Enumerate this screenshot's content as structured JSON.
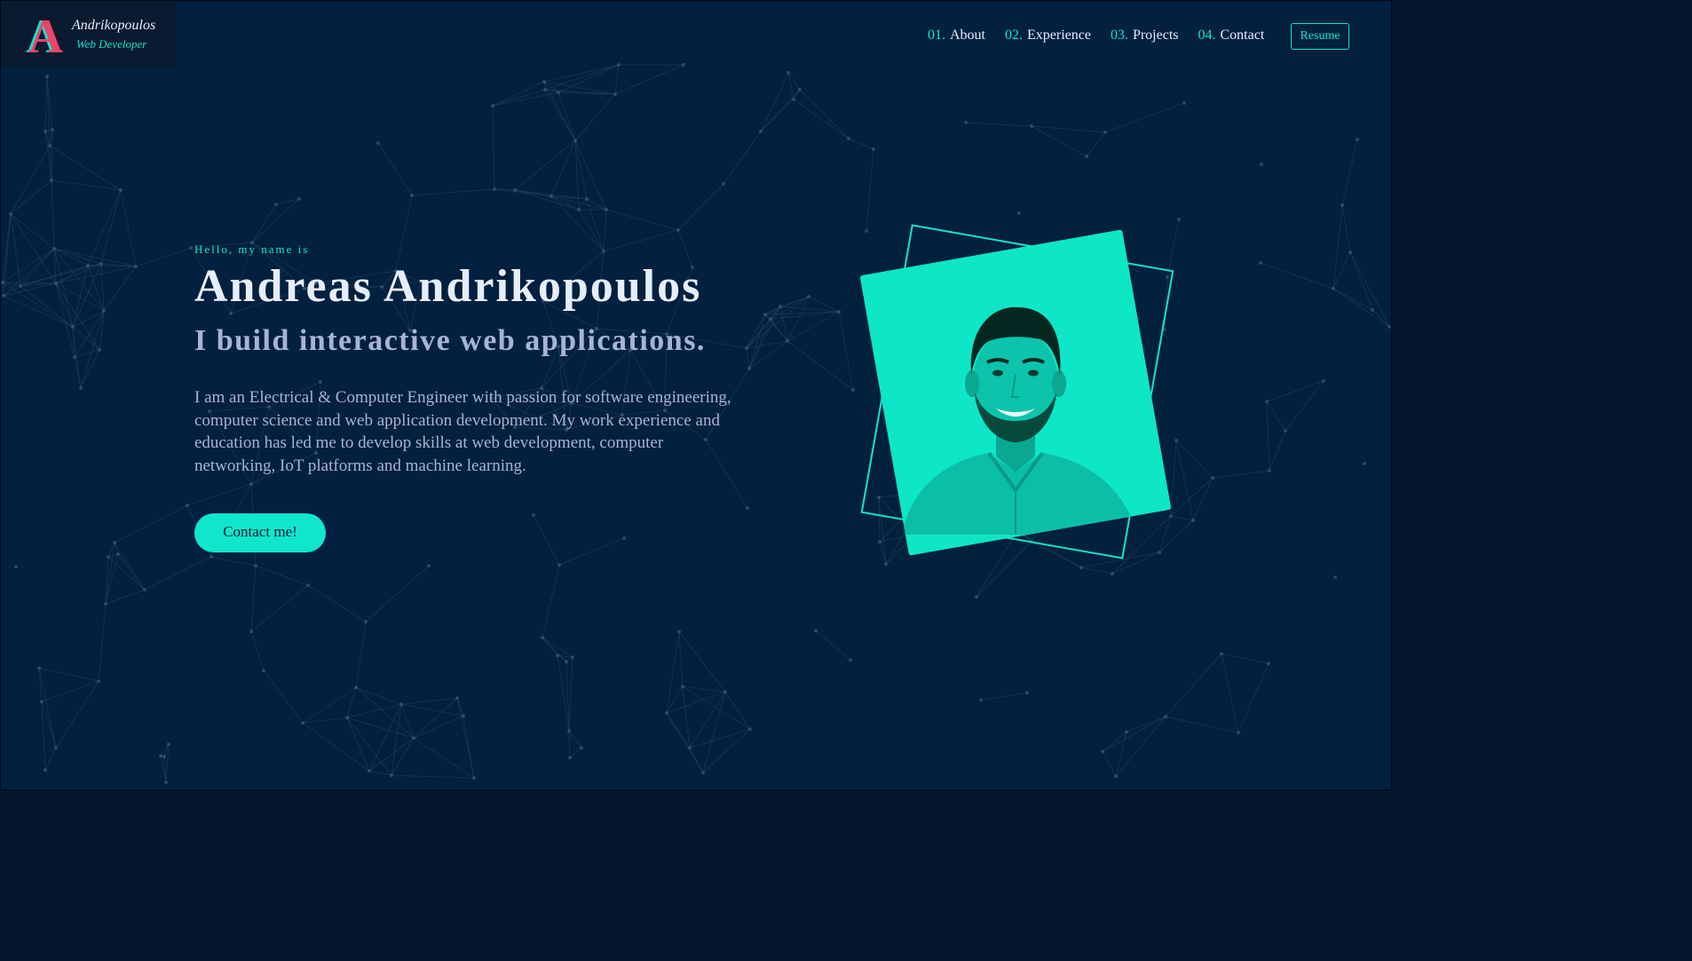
{
  "logo": {
    "letter": "A",
    "name": "Andrikopoulos",
    "role": "Web Developer"
  },
  "nav": {
    "items": [
      {
        "num": "01.",
        "label": "About"
      },
      {
        "num": "02.",
        "label": "Experience"
      },
      {
        "num": "03.",
        "label": "Projects"
      },
      {
        "num": "04.",
        "label": "Contact"
      }
    ],
    "resume_label": "Resume"
  },
  "hero": {
    "greeting": "Hello, my name is",
    "name": "Andreas Andrikopoulos",
    "tagline": "I build interactive web applications.",
    "bio": "I am an Electrical & Computer Engineer with passion for software engineering, computer science and web application development. My work experience and education has led me to develop skills at web development, computer networking, IoT platforms and machine learning.",
    "cta_label": "Contact me!"
  },
  "colors": {
    "background": "#02203f",
    "accent": "#10e6cc",
    "logo_red": "#f0436a",
    "text_light": "#e6eefc",
    "text_muted": "#a7b4d4"
  },
  "icons": {
    "logo": "logo-letter-a-icon",
    "portrait": "profile-photo"
  }
}
